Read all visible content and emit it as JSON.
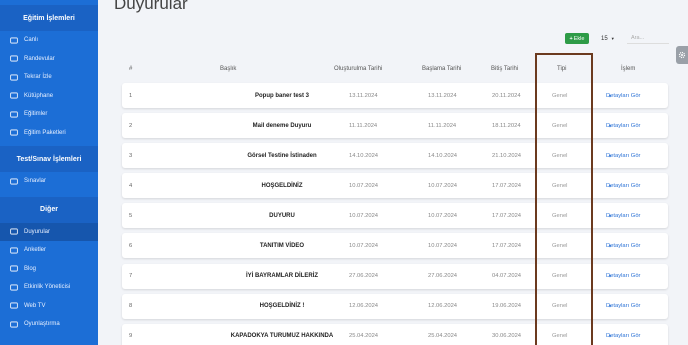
{
  "sidebar": {
    "sections": [
      {
        "title": "Eğitim İşlemleri",
        "items": [
          {
            "label": "Canlı",
            "icon": "monitor-icon"
          },
          {
            "label": "Randevular",
            "icon": "calendar-icon"
          },
          {
            "label": "Tekrar İzle",
            "icon": "replay-icon"
          },
          {
            "label": "Kütüphane",
            "icon": "library-icon"
          },
          {
            "label": "Eğitimler",
            "icon": "document-icon"
          },
          {
            "label": "Eğitim Paketleri",
            "icon": "package-icon"
          }
        ]
      },
      {
        "title": "Test/Sınav İşlemleri",
        "items": [
          {
            "label": "Sınavlar",
            "icon": "edit-icon"
          }
        ]
      },
      {
        "title": "Diğer",
        "items": [
          {
            "label": "Duyurular",
            "icon": "list-icon",
            "active": true
          },
          {
            "label": "Anketler",
            "icon": "survey-icon"
          },
          {
            "label": "Blog",
            "icon": "blog-icon"
          },
          {
            "label": "Etkinlik Yöneticisi",
            "icon": "event-icon"
          },
          {
            "label": "Web TV",
            "icon": "tv-icon"
          },
          {
            "label": "Oyunlaştırma",
            "icon": "game-icon"
          }
        ]
      }
    ]
  },
  "page": {
    "title": "Duyurular"
  },
  "toolbar": {
    "add_label": "Ekle",
    "add_icon": "+",
    "per_page": "15",
    "search_placeholder": "Ara..."
  },
  "table": {
    "headers": {
      "num": "#",
      "title": "Başlık",
      "created": "Oluşturulma Tarihi",
      "start": "Başlama Tarihi",
      "end": "Bitiş Tarihi",
      "type": "Tipi",
      "action": "İşlem"
    },
    "rows": [
      {
        "num": "1",
        "title": "Popup baner test 3",
        "created": "13.11.2024",
        "start": "13.11.2024",
        "end": "20.11.2024",
        "type": "Genel",
        "action": "Detayları Gör"
      },
      {
        "num": "2",
        "title": "Mail deneme Duyuru",
        "created": "11.11.2024",
        "start": "11.11.2024",
        "end": "18.11.2024",
        "type": "Genel",
        "action": "Detayları Gör"
      },
      {
        "num": "3",
        "title": "Görsel Testine İstinaden",
        "created": "14.10.2024",
        "start": "14.10.2024",
        "end": "21.10.2024",
        "type": "Genel",
        "action": "Detayları Gör"
      },
      {
        "num": "4",
        "title": "HOŞGELDİNİZ",
        "created": "10.07.2024",
        "start": "10.07.2024",
        "end": "17.07.2024",
        "type": "Genel",
        "action": "Detayları Gör"
      },
      {
        "num": "5",
        "title": "DUYURU",
        "created": "10.07.2024",
        "start": "10.07.2024",
        "end": "17.07.2024",
        "type": "Genel",
        "action": "Detayları Gör"
      },
      {
        "num": "6",
        "title": "TANITIM VİDEO",
        "created": "10.07.2024",
        "start": "10.07.2024",
        "end": "17.07.2024",
        "type": "Genel",
        "action": "Detayları Gör"
      },
      {
        "num": "7",
        "title": "İYİ BAYRAMLAR DİLERİZ",
        "created": "27.06.2024",
        "start": "27.06.2024",
        "end": "04.07.2024",
        "type": "Genel",
        "action": "Detayları Gör"
      },
      {
        "num": "8",
        "title": "HOŞGELDİNİZ !",
        "created": "12.06.2024",
        "start": "12.06.2024",
        "end": "19.06.2024",
        "type": "Genel",
        "action": "Detayları Gör"
      },
      {
        "num": "9",
        "title": "KAPADOKYA TURUMUZ HAKKINDA",
        "created": "25.04.2024",
        "start": "25.04.2024",
        "end": "30.06.2024",
        "type": "Genel",
        "action": "Detayları Gör"
      }
    ]
  },
  "colors": {
    "sidebar": "#1c6ed6",
    "add_button": "#2e9b47",
    "link": "#2b72d6",
    "highlight_border": "#6b3a1f"
  }
}
